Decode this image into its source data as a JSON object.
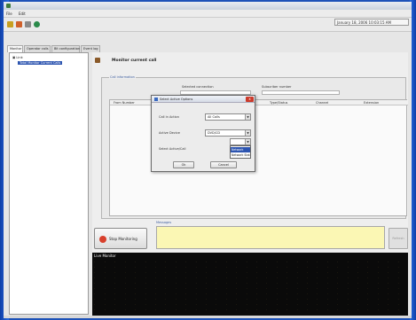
{
  "window": {
    "title": "",
    "app_icon": "app-icon"
  },
  "menu": {
    "items": [
      "File",
      "Edit"
    ]
  },
  "toolbar": {
    "icons": [
      {
        "name": "connect-icon",
        "color": "#c8a020"
      },
      {
        "name": "settings-icon",
        "color": "#d0602a"
      },
      {
        "name": "wrench-icon",
        "color": "#8a8a8a"
      },
      {
        "name": "globe-icon",
        "color": "#2a8a4a"
      }
    ],
    "datetime": "January 18, 2006 10:03:15 AM"
  },
  "tabs": [
    "Monitor",
    "Operator calls",
    "Bit configuration",
    "Event log"
  ],
  "tree": {
    "root": "Link",
    "selected": "Total Monitor Current Calls"
  },
  "main": {
    "title": "Monitor current call",
    "group_title": "Call information",
    "selected_connection_label": "Selected connection",
    "subscriber_label": "Subscriber number",
    "columns": [
      "From Number",
      "",
      "",
      "",
      "Type/Status",
      "Channel",
      "Extension"
    ]
  },
  "dialog": {
    "title": "Select Active Options",
    "close": "x",
    "fields": [
      {
        "label": "Call in Action",
        "value": "All Calls"
      },
      {
        "label": "Active Device",
        "value": "DVD/CD"
      },
      {
        "label": "Select Active/Call",
        "value": ""
      }
    ],
    "dropdown_options": [
      "Network",
      "Network Status"
    ],
    "ok_label": "Ok",
    "cancel_label": "Cancel"
  },
  "bottom": {
    "stop_label": "Stop Monitoring",
    "message_title": "Messages",
    "gray_button": "Refresh"
  },
  "live_monitor": {
    "title": "Live Monitor",
    "columns": 30,
    "rows": 10
  },
  "colors": {
    "desktop": "#1d52b8",
    "selection": "#2d55b0",
    "message_bg": "#fbf7b4",
    "monitor_bg": "#0a0a0a",
    "monitor_text": "#d8b040"
  }
}
